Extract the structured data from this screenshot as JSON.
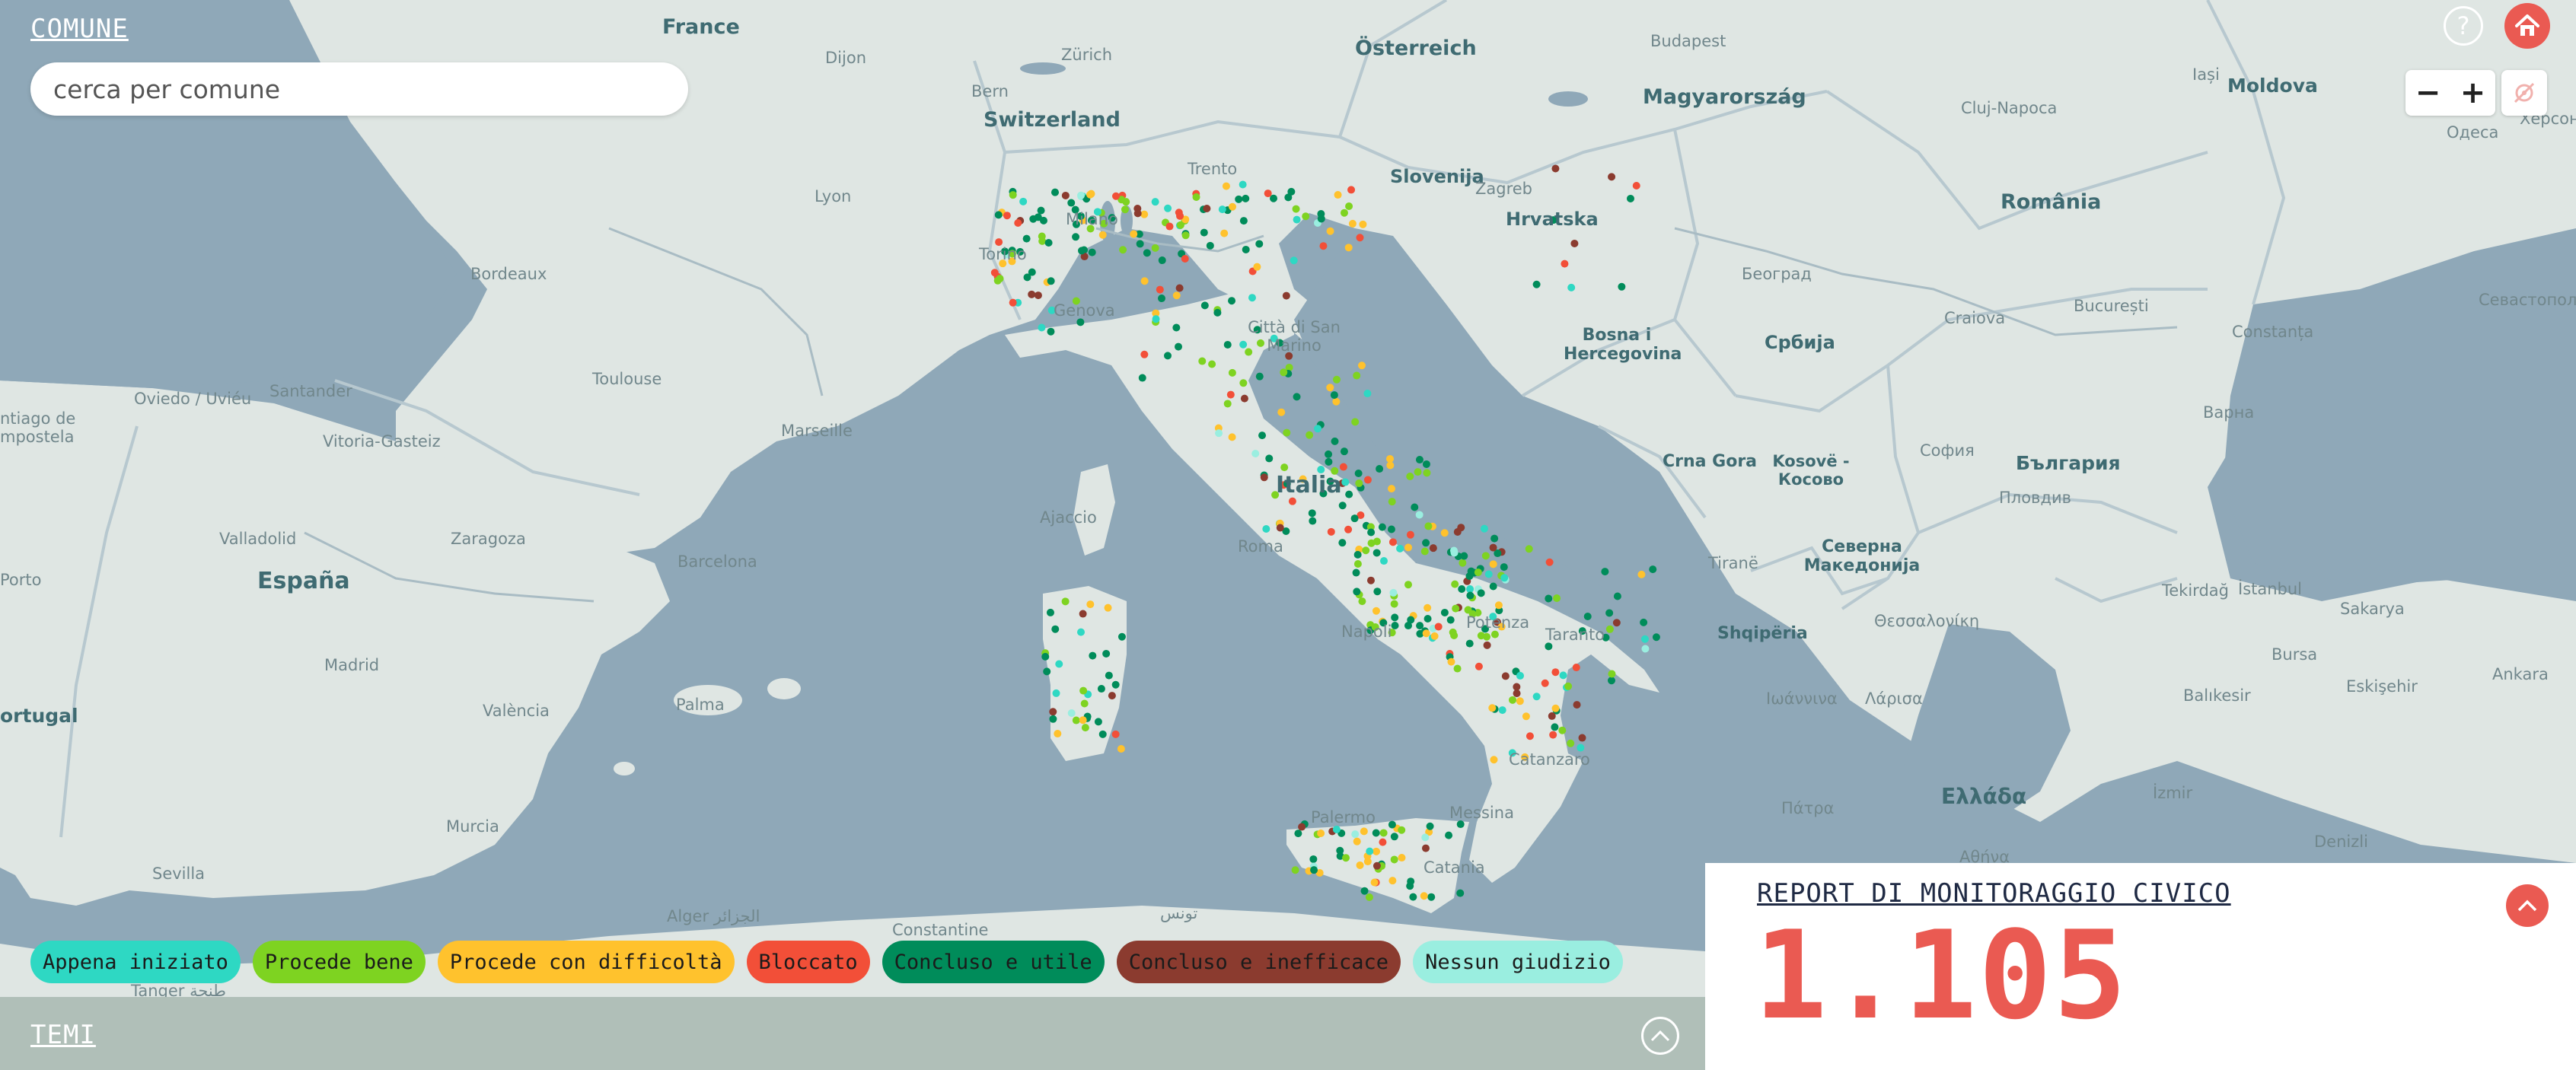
{
  "search": {
    "label": "COMUNE",
    "placeholder": "cerca per comune"
  },
  "controls": {
    "help": "?",
    "zoom_out": "−",
    "zoom_in": "+"
  },
  "map_labels": {
    "countries": [
      "France",
      "Switzerland",
      "Österreich",
      "Magyarország",
      "România",
      "Moldova",
      "Slovenija",
      "Hrvatska",
      "Bosna i Hercegovina",
      "Србија",
      "Italia",
      "España",
      "Crna Gora",
      "Kosovë - Косово",
      "Северна Македонија",
      "Shqipëria",
      "България",
      "Ελλάδα",
      "ortugal"
    ],
    "cities": [
      "Dijon",
      "Zürich",
      "Bern",
      "Budapest",
      "Cluj-Napoca",
      "Iași",
      "Одеса",
      "Херсон",
      "Lyon",
      "Trento",
      "Zagreb",
      "Milano",
      "Torino",
      "Genova",
      "Bordeaux",
      "Città di San Marino",
      "Београд",
      "Craiova",
      "București",
      "Constanța",
      "Севастополь",
      "Toulouse",
      "Oviedo / Uviéu",
      "Santander",
      "ntiago de mpostela",
      "Vitoria-Gasteiz",
      "Marseille",
      "Варна",
      "София",
      "Пловдив",
      "Ajaccio",
      "Roma",
      "Valladolid",
      "Zaragoza",
      "Barcelona",
      "Porto",
      "Tiranë",
      "Tekirdağ",
      "İstanbul",
      "Napoli",
      "Potenza",
      "Taranto",
      "Sakarya",
      "Θεσσαλονίκη",
      "Madrid",
      "Bursa",
      "València",
      "Eskişehir",
      "Ankara",
      "Palma",
      "Ιωάννινα",
      "Λάρισα",
      "Balıkesir",
      "Catanzaro",
      "Πάτρα",
      "İzmir",
      "Palermo",
      "Messina",
      "Denizli",
      "Murcia",
      "Catania",
      "Αθήνα",
      "Sevilla",
      "Alger الجزائر",
      "Constantine",
      "تونس",
      "Tanger طنجة"
    ]
  },
  "legend": [
    {
      "label": "Appena iniziato",
      "color": "#2ed8c3"
    },
    {
      "label": "Procede bene",
      "color": "#7ed321"
    },
    {
      "label": "Procede con difficoltà",
      "color": "#ffc22d"
    },
    {
      "label": "Bloccato",
      "color": "#f24f38"
    },
    {
      "label": "Concluso e utile",
      "color": "#008c5a"
    },
    {
      "label": "Concluso e inefficace",
      "color": "#8b3b2f"
    },
    {
      "label": "Nessun giudizio",
      "color": "#9aeee0"
    }
  ],
  "temi": {
    "label": "TEMI"
  },
  "report": {
    "title": "REPORT DI MONITORAGGIO CIVICO",
    "count": "1.105"
  },
  "colors": {
    "sea": "#8fa8b8",
    "land": "#dfe6e3",
    "accent": "#ea5a52",
    "temi_bar": "#b0bfb8"
  }
}
